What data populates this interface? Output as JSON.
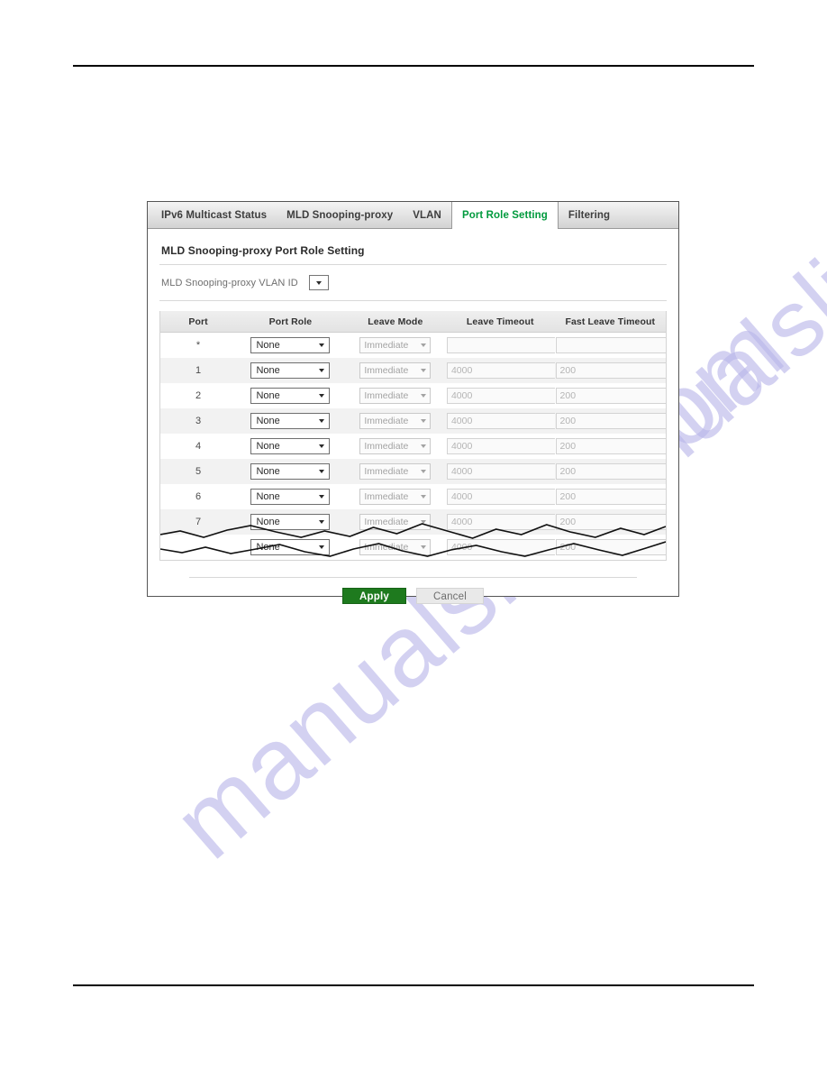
{
  "page": {
    "rules": {
      "top": "horizontal-rule",
      "bottom": "horizontal-rule"
    },
    "watermark": "manualslive.com"
  },
  "panel": {
    "tabs": [
      {
        "label": "IPv6 Multicast Status",
        "active": false
      },
      {
        "label": "MLD Snooping-proxy",
        "active": false
      },
      {
        "label": "VLAN",
        "active": false
      },
      {
        "label": "Port Role Setting",
        "active": true
      },
      {
        "label": "Filtering",
        "active": false
      }
    ],
    "section_title": "MLD Snooping-proxy Port Role Setting",
    "vlan": {
      "label": "MLD Snooping-proxy VLAN ID",
      "selected": "",
      "icon": "chevron-down-icon"
    },
    "table": {
      "headers": [
        "Port",
        "Port Role",
        "Leave Mode",
        "Leave Timeout",
        "Fast Leave Timeout"
      ],
      "rows": [
        {
          "port": "*",
          "role": "None",
          "mode": "Immediate",
          "leave_timeout": "",
          "fast_leave_timeout": ""
        },
        {
          "port": "1",
          "role": "None",
          "mode": "Immediate",
          "leave_timeout": "4000",
          "fast_leave_timeout": "200"
        },
        {
          "port": "2",
          "role": "None",
          "mode": "Immediate",
          "leave_timeout": "4000",
          "fast_leave_timeout": "200"
        },
        {
          "port": "3",
          "role": "None",
          "mode": "Immediate",
          "leave_timeout": "4000",
          "fast_leave_timeout": "200"
        },
        {
          "port": "4",
          "role": "None",
          "mode": "Immediate",
          "leave_timeout": "4000",
          "fast_leave_timeout": "200"
        },
        {
          "port": "5",
          "role": "None",
          "mode": "Immediate",
          "leave_timeout": "4000",
          "fast_leave_timeout": "200"
        },
        {
          "port": "6",
          "role": "None",
          "mode": "Immediate",
          "leave_timeout": "4000",
          "fast_leave_timeout": "200"
        },
        {
          "port": "7",
          "role": "None",
          "mode": "Immediate",
          "leave_timeout": "4000",
          "fast_leave_timeout": "200"
        },
        {
          "port": "",
          "role": "None",
          "mode": "Immediate",
          "leave_timeout": "4000",
          "fast_leave_timeout": "200"
        }
      ]
    },
    "buttons": {
      "apply": "Apply",
      "cancel": "Cancel"
    },
    "colors": {
      "active_tab_text": "#009a3d",
      "apply_button": "#1e7a1e",
      "cancel_button": "#e9e9e9",
      "watermark": "#b9b6ea"
    }
  }
}
